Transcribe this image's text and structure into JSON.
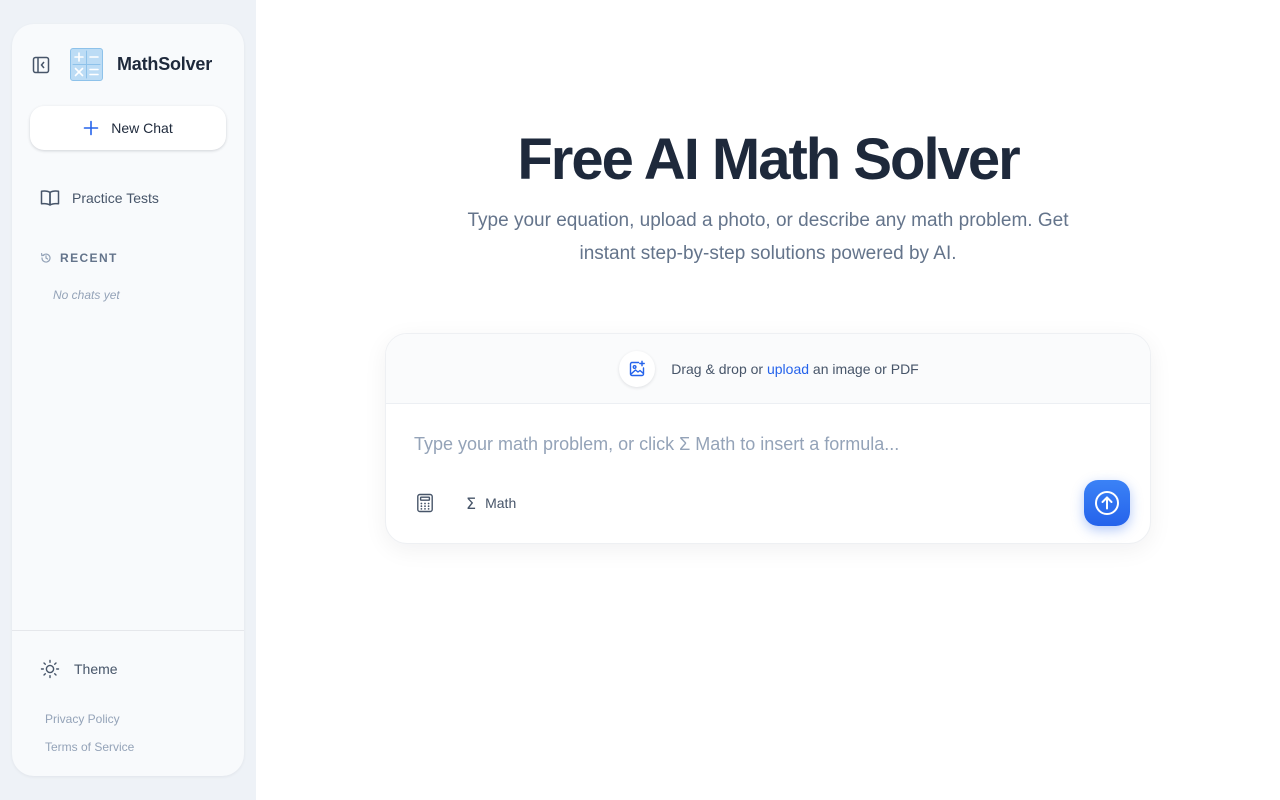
{
  "sidebar": {
    "brand": "MathSolver",
    "new_chat_label": "New Chat",
    "practice_label": "Practice Tests",
    "recent_label": "RECENT",
    "no_chats": "No chats yet",
    "theme_label": "Theme",
    "privacy_label": "Privacy Policy",
    "terms_label": "Terms of Service",
    "icons": {
      "collapse": "sidebar-collapse-icon",
      "logo": "calculator-logo",
      "new_chat": "plus-icon",
      "practice": "book-open-icon",
      "recent": "history-icon",
      "theme": "sun-icon"
    }
  },
  "hero": {
    "title": "Free AI Math Solver",
    "subtitle": "Type your equation, upload a photo, or describe any math problem. Get instant step-by-step solutions powered by AI."
  },
  "composer": {
    "upload_prefix": "Drag & drop or ",
    "upload_link": "upload",
    "upload_suffix": " an image or PDF",
    "placeholder": "Type your math problem, or click Σ Math to insert a formula...",
    "math_symbol": "Σ",
    "math_label": "Math",
    "icons": {
      "upload": "image-plus-icon",
      "calculator": "calculator-icon",
      "send": "arrow-up-circle-icon"
    }
  },
  "colors": {
    "accent": "#2563eb",
    "sidebar_bg": "#f8fafc",
    "title": "#1e293b",
    "muted": "#64748b"
  }
}
